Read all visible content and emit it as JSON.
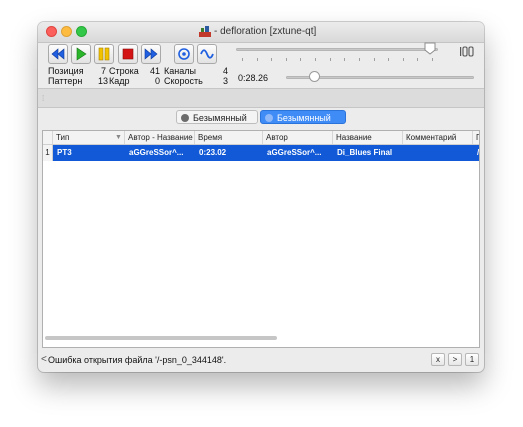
{
  "window": {
    "title": "- defloration [zxtune-qt]"
  },
  "status": {
    "position_label": "Позиция",
    "position_value": "7",
    "row_label": "Строка",
    "row_value": "41",
    "channels_label": "Каналы",
    "channels_value": "4",
    "pattern_label": "Паттерн",
    "pattern_value": "13",
    "frame_label": "Кадр",
    "frame_value": "0",
    "speed_label": "Скорость",
    "speed_value": "3",
    "time": "0:28.26",
    "seek_fraction": 0.15,
    "volume_fraction": 0.96
  },
  "tabs": [
    {
      "label": "Безымянный",
      "active": false
    },
    {
      "label": "Безымянный",
      "active": true
    }
  ],
  "playlist": {
    "columns": [
      "Тип",
      "Автор - Название",
      "Время",
      "Автор",
      "Название",
      "Комментарий",
      "П"
    ],
    "rows": [
      {
        "num": "1",
        "type": "PT3",
        "author_title": "aGGreSSor^...",
        "time": "0:23.02",
        "author": "aGGreSSor^...",
        "title": "Di_Blues Final",
        "comment": "",
        "extra": "/"
      }
    ]
  },
  "statusbar": {
    "prev_arrow": "<",
    "message": "Ошибка открытия файла '/-psn_0_344148'.",
    "close_label": "x",
    "next_label": ">",
    "count": "1"
  },
  "colors": {
    "selection": "#1159d6",
    "tab_active": "#3f8cf6",
    "play": "#2bb52b",
    "pause": "#f2c200",
    "stop": "#d41414",
    "nav_blue": "#1f5fe0"
  }
}
